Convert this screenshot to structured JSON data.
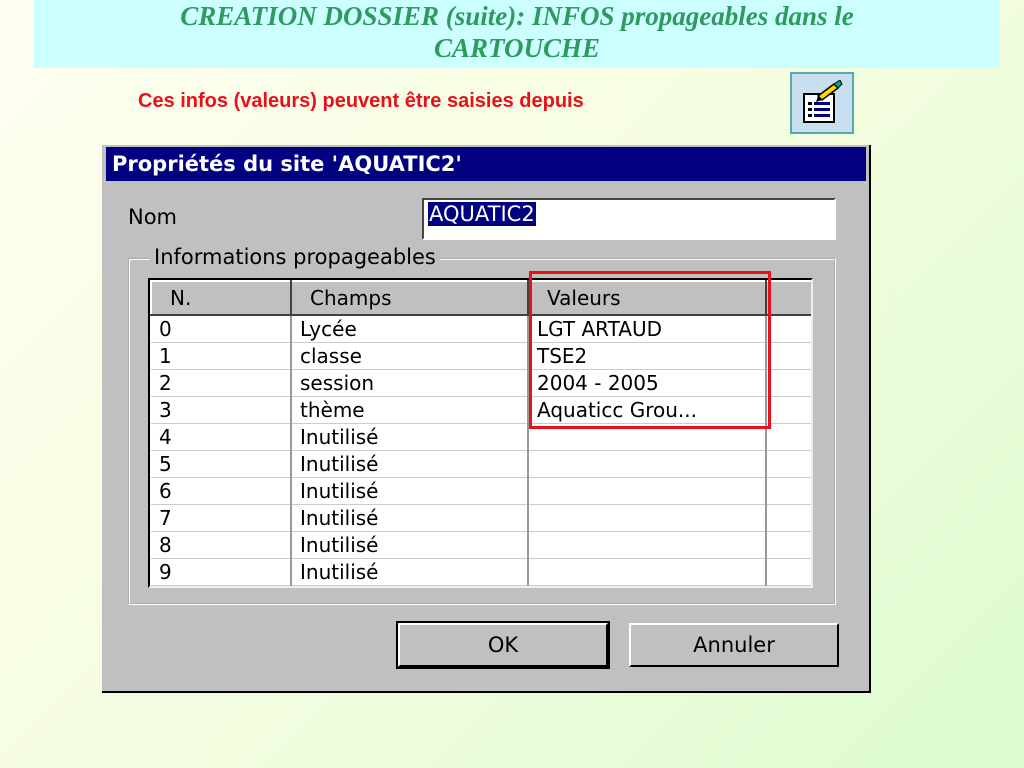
{
  "slide": {
    "title_line1": "CREATION DOSSIER (suite): INFOS propageables dans le",
    "title_line2": "CARTOUCHE",
    "subtitle": "Ces infos (valeurs) peuvent être saisies depuis",
    "properties_icon": "properties-icon"
  },
  "dialog": {
    "caption": "Propriétés du site 'AQUATIC2'",
    "nom_label": "Nom",
    "nom_value": "AQUATIC2",
    "group_label": "Informations propageables",
    "columns": [
      "N.",
      "Champs",
      "Valeurs"
    ],
    "rows": [
      {
        "n": "0",
        "champ": "Lycée",
        "valeur": "LGT ARTAUD"
      },
      {
        "n": "1",
        "champ": "classe",
        "valeur": "TSE2"
      },
      {
        "n": "2",
        "champ": "session",
        "valeur": "2004 - 2005"
      },
      {
        "n": "3",
        "champ": "thème",
        "valeur": "Aquaticc Grou..."
      },
      {
        "n": "4",
        "champ": "Inutilisé",
        "valeur": ""
      },
      {
        "n": "5",
        "champ": "Inutilisé",
        "valeur": ""
      },
      {
        "n": "6",
        "champ": "Inutilisé",
        "valeur": ""
      },
      {
        "n": "7",
        "champ": "Inutilisé",
        "valeur": ""
      },
      {
        "n": "8",
        "champ": "Inutilisé",
        "valeur": ""
      },
      {
        "n": "9",
        "champ": "Inutilisé",
        "valeur": ""
      }
    ],
    "ok_label": "OK",
    "cancel_label": "Annuler"
  },
  "colors": {
    "title": "#2e9a5e",
    "title_band": "#ccffff",
    "subtitle": "#e8101a",
    "highlight": "#e8101a",
    "caption_bar": "#000080"
  }
}
